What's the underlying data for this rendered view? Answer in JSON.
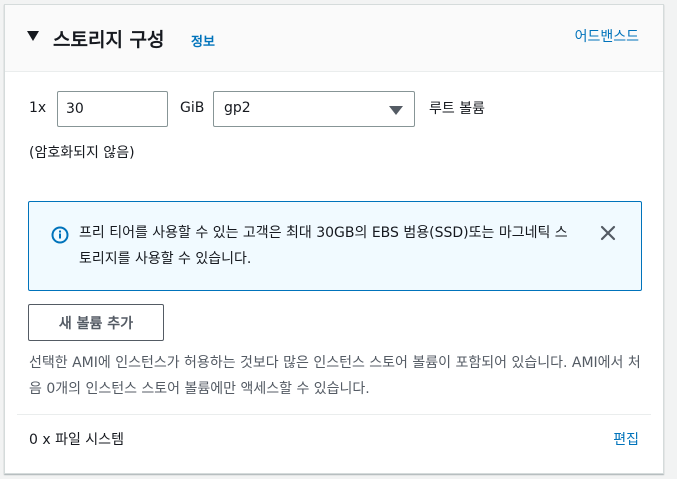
{
  "header": {
    "title": "스토리지 구성",
    "info_link": "정보",
    "advanced_link": "어드밴스드"
  },
  "volume": {
    "multiplier": "1x",
    "size_value": "30",
    "unit": "GiB",
    "volume_type": "gp2",
    "root_label": "루트 볼륨",
    "encryption_status": "(암호화되지 않음)"
  },
  "alert": {
    "text": "프리 티어를 사용할 수 있는 고객은 최대 30GB의 EBS 범용(SSD)또는 마그네틱 스토리지를 사용할 수 있습니다.",
    "icon": "info-icon",
    "close_icon": "close-icon"
  },
  "actions": {
    "add_volume_label": "새 볼륨 추가"
  },
  "description": "선택한 AMI에 인스턴스가 허용하는 것보다 많은 인스턴스 스토어 볼륨이 포함되어 있습니다. AMI에서 처음 0개의 인스턴스 스토어 볼륨에만 액세스할 수 있습니다.",
  "file_systems": {
    "label": "0 x 파일 시스템",
    "edit_link": "편집"
  },
  "colors": {
    "link": "#0073bb",
    "alert_background": "#f1faff",
    "alert_border": "#0073bb"
  }
}
